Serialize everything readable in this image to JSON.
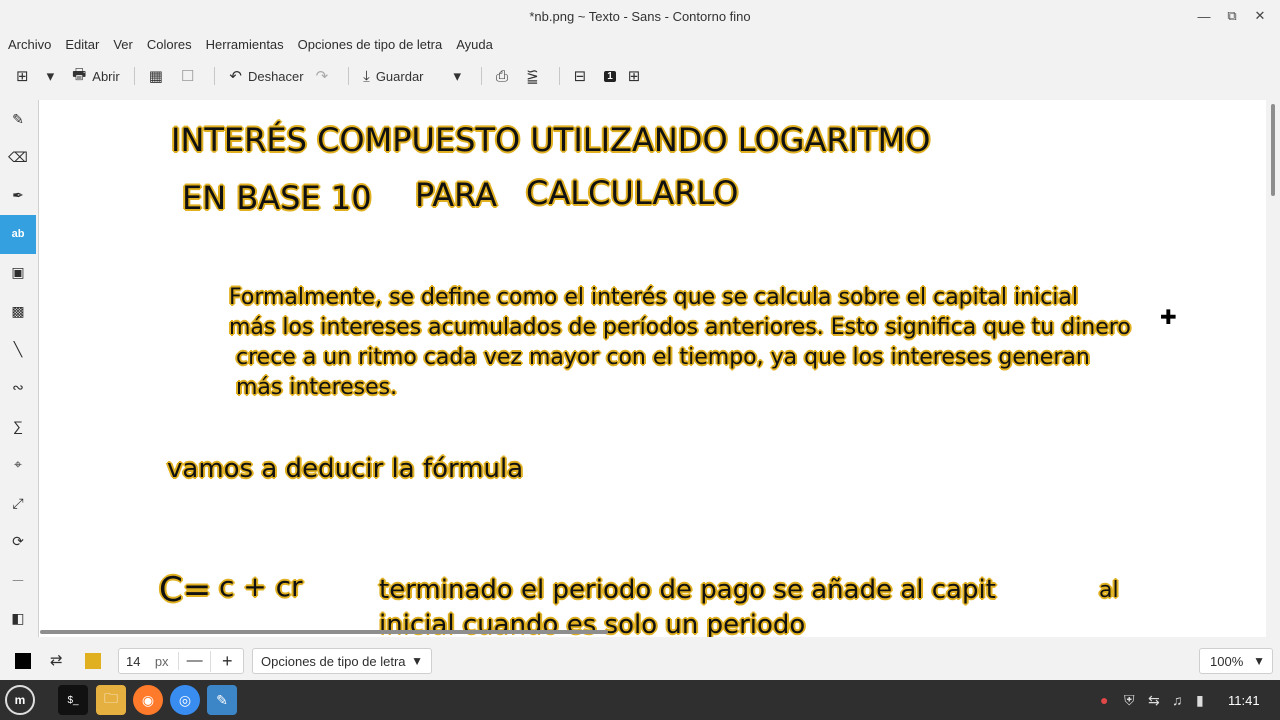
{
  "window": {
    "title": "*nb.png ~ Texto - Sans - Contorno fino"
  },
  "menu": [
    "Archivo",
    "Editar",
    "Ver",
    "Colores",
    "Herramientas",
    "Opciones de tipo de letra",
    "Ayuda"
  ],
  "toolbar": {
    "open_label": "Abrir",
    "undo_label": "Deshacer",
    "save_label": "Guardar",
    "zoom_one_label": "1"
  },
  "canvas": {
    "title_line1": "INTERÉS COMPUESTO UTILIZANDO LOGARITMO",
    "title_line2a": "EN BASE 10",
    "title_line2b": "PARA",
    "title_line2c": "CALCULARLO",
    "para_line1": "Formalmente, se define como el interés que se calcula sobre el capital inicial",
    "para_line2": "más los intereses acumulados de períodos anteriores. Esto significa que tu dinero",
    "para_line3": "crece a un ritmo cada vez mayor con el tiempo, ya que los intereses generan",
    "para_line4": "más intereses.",
    "deduce": "vamos a deducir la fórmula",
    "formula_c": "C=",
    "formula_rest": "c + cr",
    "explain_line1a": "terminado el periodo de pago se añade al capit",
    "explain_line1b": "al",
    "explain_line2": "inicial  cuando es solo un periodo"
  },
  "bottom": {
    "size_value": "14",
    "size_unit": "px",
    "font_options_label": "Opciones de tipo de letra",
    "zoom_value": "100%"
  },
  "colors": {
    "primary": "#000000",
    "secondary": "#e0b020",
    "accent": "#35a0e0"
  },
  "taskbar": {
    "clock": "11:41"
  }
}
